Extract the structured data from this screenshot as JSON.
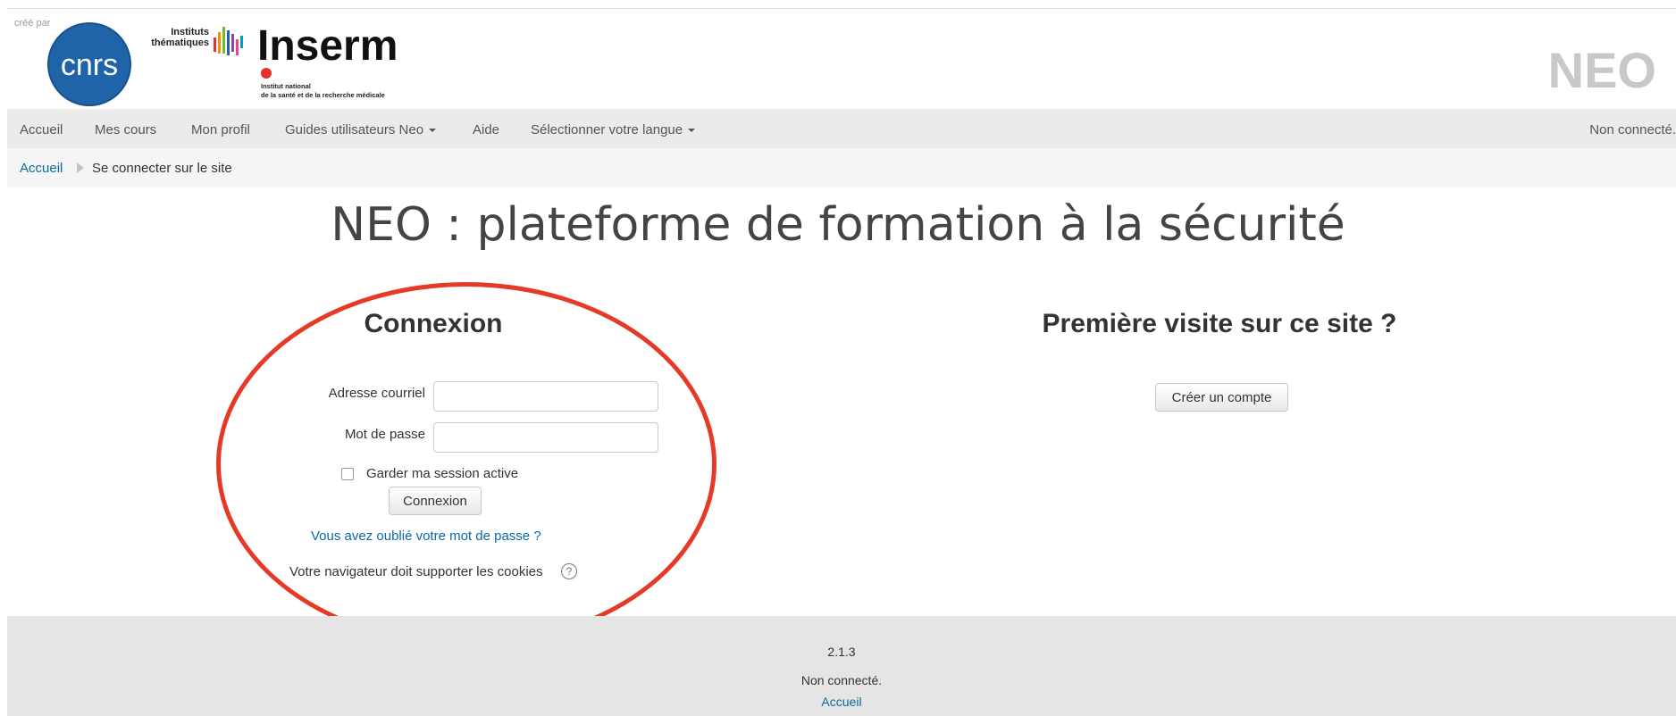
{
  "header": {
    "cree_par": "créé par",
    "cnrs_logo_text": "cnrs",
    "instituts_line1": "Instituts",
    "instituts_line2": "thématiques",
    "inserm_title": "Inserm",
    "inserm_subtitle_line1": "Institut national",
    "inserm_subtitle_line2": "de la santé et de la recherche médicale",
    "brand": "NEO",
    "colors": {
      "cnrs_blue": "#1f63a8",
      "inserm_red": "#e4312b"
    }
  },
  "nav": {
    "items": [
      {
        "label": "Accueil"
      },
      {
        "label": "Mes cours"
      },
      {
        "label": "Mon profil"
      },
      {
        "label": "Guides utilisateurs Neo",
        "dropdown": true
      },
      {
        "label": "Aide"
      },
      {
        "label": "Sélectionner votre langue",
        "dropdown": true
      }
    ],
    "status": "Non connecté."
  },
  "breadcrumb": {
    "home": "Accueil",
    "current": "Se connecter sur le site"
  },
  "page": {
    "title": "NEO : plateforme de formation à la sécurité"
  },
  "login": {
    "heading": "Connexion",
    "email_label": "Adresse courriel",
    "email_value": "",
    "password_label": "Mot de passe",
    "password_value": "",
    "remember_label": "Garder ma session active",
    "remember_checked": false,
    "submit_label": "Connexion",
    "forgot_link": "Vous avez oublié votre mot de passe ?",
    "cookies_note": "Votre navigateur doit supporter les cookies",
    "help_icon": "question-circle-icon"
  },
  "signup": {
    "heading": "Première visite sur ce site ?",
    "button_label": "Créer un compte"
  },
  "footer": {
    "version": "2.1.3",
    "status": "Non connecté.",
    "home_link": "Accueil"
  },
  "annotation": {
    "color": "#e53a27",
    "shape": "ellipse"
  }
}
